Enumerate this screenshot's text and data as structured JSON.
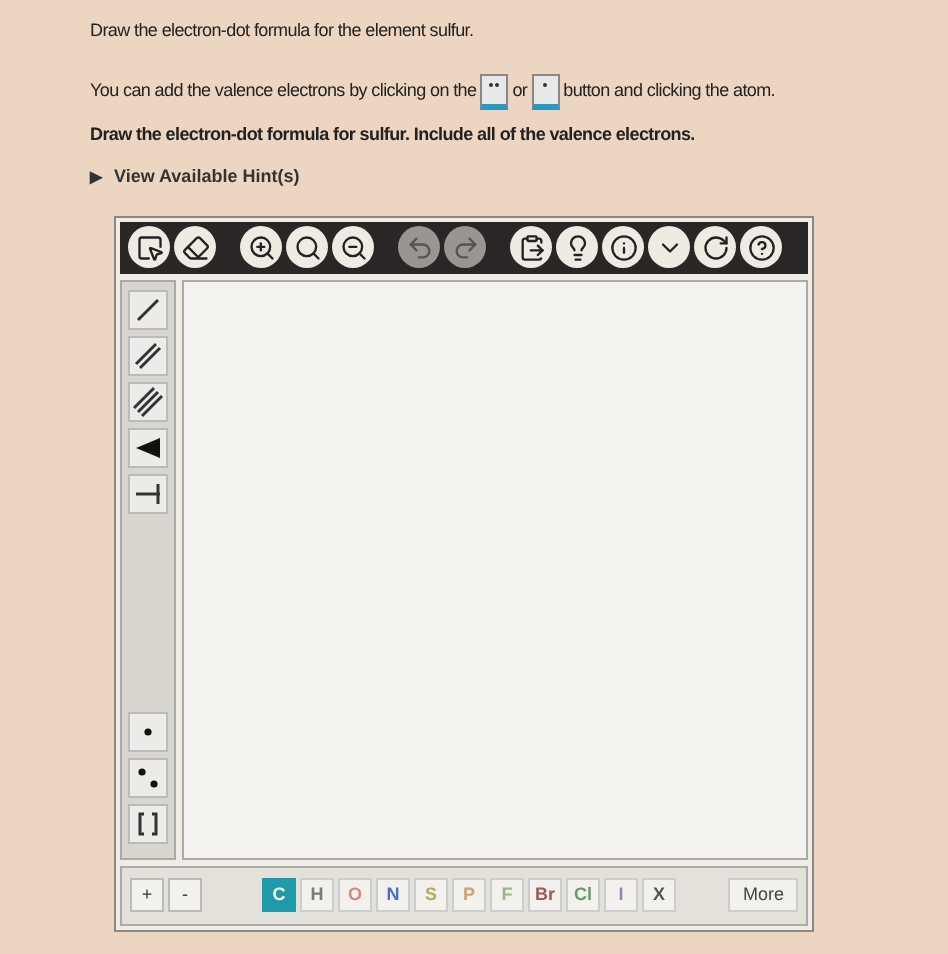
{
  "question": "Draw the electron-dot formula for the element sulfur.",
  "instruction": {
    "before": "You can add the valence electrons by clicking on the",
    "middle": "or",
    "after": "button and clicking the atom."
  },
  "task": "Draw the electron-dot formula for sulfur. Include all of the valence electrons.",
  "hints": {
    "arrow": "▶",
    "label": "View Available Hint(s)",
    "expanded": false
  },
  "toolbar": [
    {
      "kind": "select",
      "disabled": false
    },
    {
      "kind": "erase",
      "disabled": false
    },
    {
      "kind": "zoom-in",
      "disabled": false
    },
    {
      "kind": "zoom-fit",
      "disabled": false
    },
    {
      "kind": "zoom-out",
      "disabled": false
    },
    {
      "kind": "undo",
      "disabled": true
    },
    {
      "kind": "redo",
      "disabled": true
    },
    {
      "kind": "paste",
      "disabled": false
    },
    {
      "kind": "hint",
      "disabled": false
    },
    {
      "kind": "info",
      "disabled": false
    },
    {
      "kind": "more",
      "disabled": false
    },
    {
      "kind": "reset",
      "disabled": false
    },
    {
      "kind": "help",
      "disabled": false
    }
  ],
  "bond_tools": [
    {
      "kind": "single"
    },
    {
      "kind": "double"
    },
    {
      "kind": "triple"
    },
    {
      "kind": "wedge"
    },
    {
      "kind": "hash"
    }
  ],
  "dot_tools": [
    {
      "kind": "single-dot"
    },
    {
      "kind": "pair-dot"
    },
    {
      "kind": "bracket"
    }
  ],
  "charges": [
    "+",
    "-"
  ],
  "elements": [
    {
      "symbol": "C",
      "selected": true,
      "color": "#1f9aa8"
    },
    {
      "symbol": "H",
      "selected": false,
      "color": "#7a7a7a"
    },
    {
      "symbol": "O",
      "selected": false,
      "color": "#d08a7a"
    },
    {
      "symbol": "N",
      "selected": false,
      "color": "#4a6fc0"
    },
    {
      "symbol": "S",
      "selected": false,
      "color": "#b8a860"
    },
    {
      "symbol": "P",
      "selected": false,
      "color": "#d0a070"
    },
    {
      "symbol": "F",
      "selected": false,
      "color": "#9ab880"
    },
    {
      "symbol": "Br",
      "selected": false,
      "color": "#9a5a5a"
    },
    {
      "symbol": "Cl",
      "selected": false,
      "color": "#6a9a6a"
    },
    {
      "symbol": "I",
      "selected": false,
      "color": "#a080b0"
    },
    {
      "symbol": "X",
      "selected": false,
      "color": "#555555"
    }
  ],
  "more_button": "More"
}
